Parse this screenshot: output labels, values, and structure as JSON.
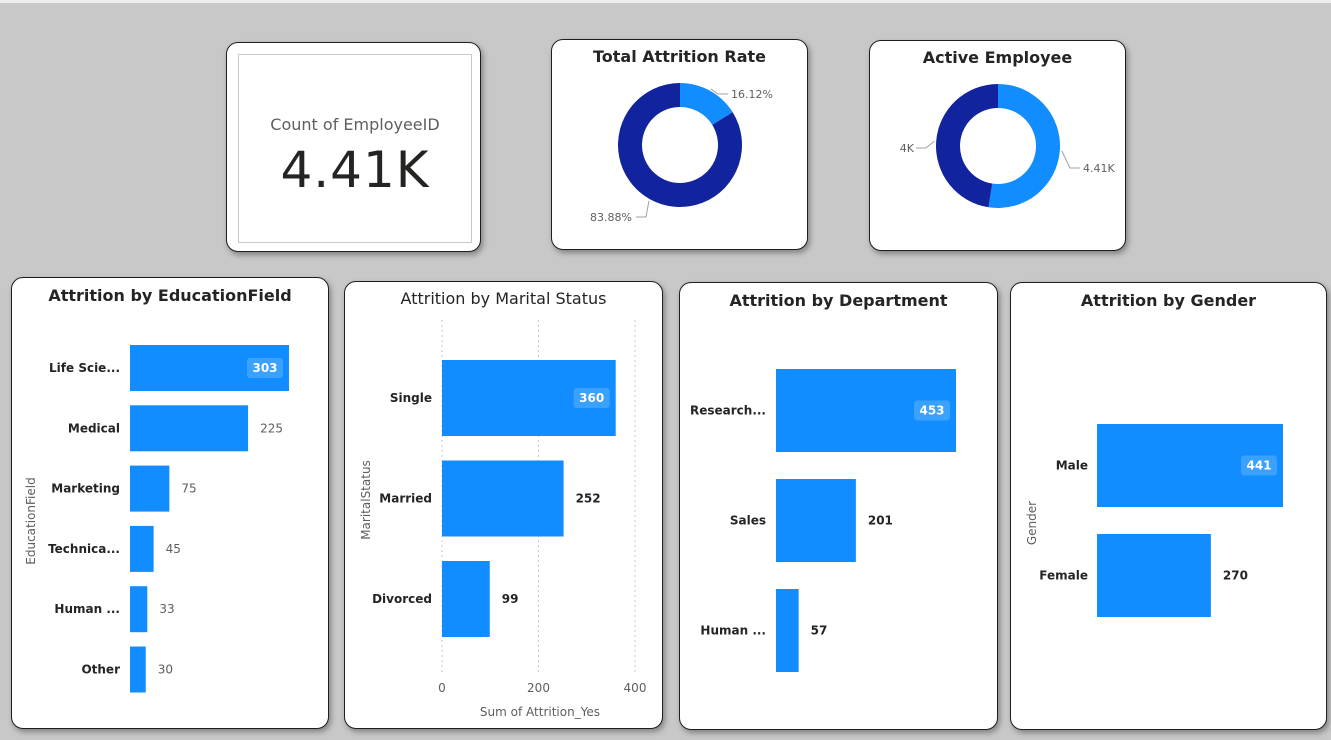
{
  "kpi": {
    "label": "Count of EmployeeID",
    "value": "4.41K"
  },
  "chart_data": [
    {
      "id": "attrition_rate",
      "type": "pie",
      "title": "Total Attrition Rate",
      "labels": [
        "16.12%",
        "83.88%"
      ],
      "values": [
        16.12,
        83.88
      ],
      "colors": [
        "#118dff",
        "#12239e"
      ]
    },
    {
      "id": "active_employee",
      "type": "pie",
      "title": "Active Employee",
      "labels": [
        "4.41K",
        "4K"
      ],
      "values": [
        4410,
        4000
      ],
      "colors": [
        "#118dff",
        "#12239e"
      ]
    },
    {
      "id": "education",
      "type": "bar",
      "title": "Attrition by EducationField",
      "ylabel": "EducationField",
      "categories": [
        "Life Scie...",
        "Medical",
        "Marketing",
        "Technica...",
        "Human ...",
        "Other"
      ],
      "values": [
        303,
        225,
        75,
        45,
        33,
        30
      ],
      "color": "#118dff"
    },
    {
      "id": "marital",
      "type": "bar",
      "title": "Attrition by Marital Status",
      "xlabel": "Sum of Attrition_Yes",
      "ylabel": "MaritalStatus",
      "categories": [
        "Single",
        "Married",
        "Divorced"
      ],
      "values": [
        360,
        252,
        99
      ],
      "xticks": [
        0,
        200,
        400
      ],
      "xlim": [
        0,
        400
      ],
      "grid": true,
      "color": "#118dff"
    },
    {
      "id": "department",
      "type": "bar",
      "title": "Attrition by Department",
      "categories": [
        "Research...",
        "Sales",
        "Human ..."
      ],
      "values": [
        453,
        201,
        57
      ],
      "color": "#118dff"
    },
    {
      "id": "gender",
      "type": "bar",
      "title": "Attrition by Gender",
      "ylabel": "Gender",
      "categories": [
        "Male",
        "Female"
      ],
      "values": [
        441,
        270
      ],
      "color": "#118dff"
    }
  ]
}
